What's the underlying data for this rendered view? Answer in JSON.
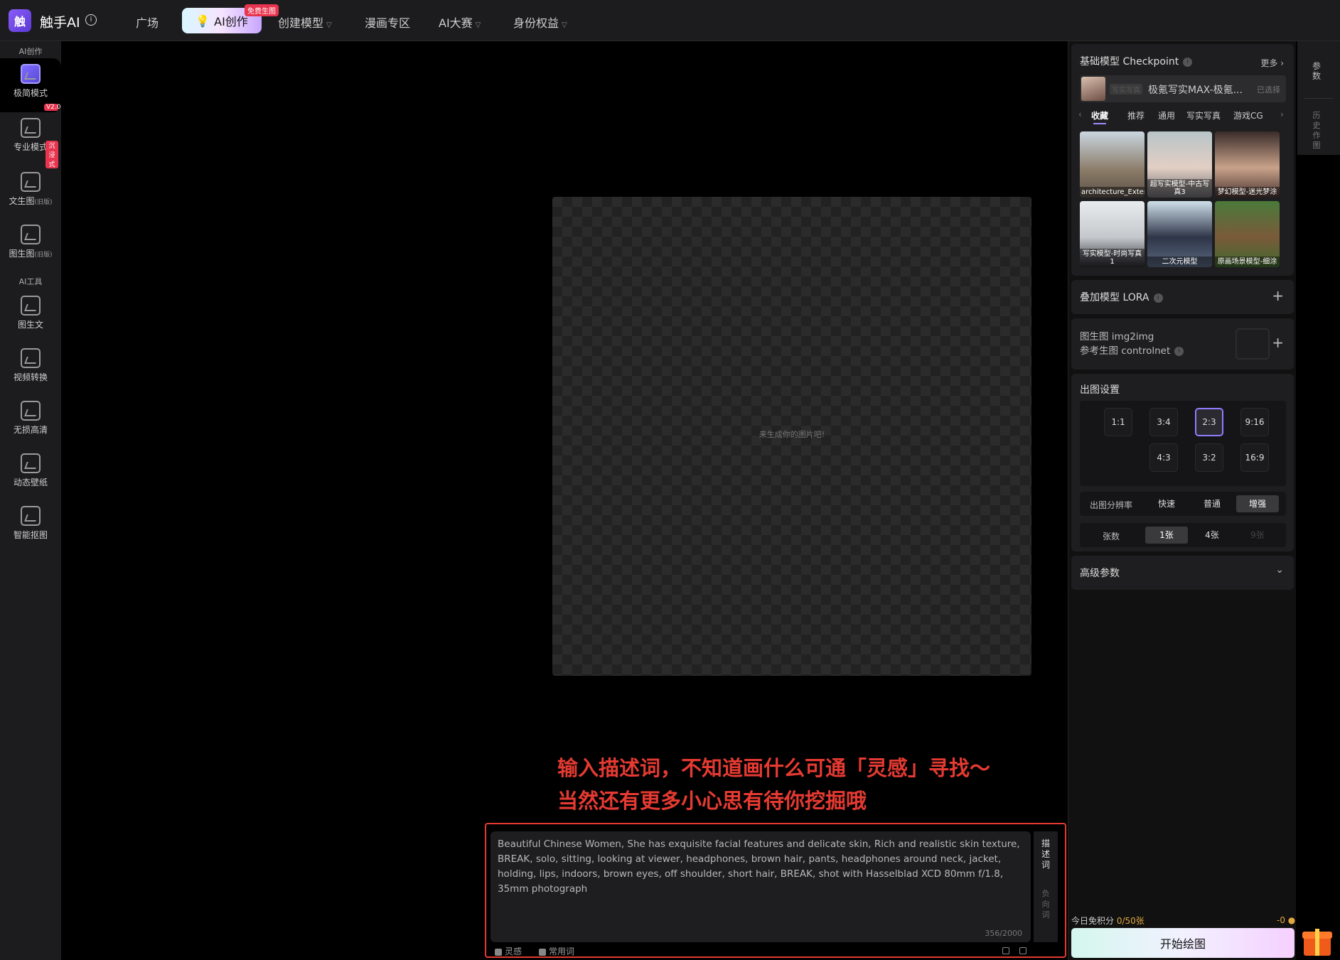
{
  "brand": {
    "name": "触手AI",
    "logo_char": "触"
  },
  "nav": {
    "items": [
      {
        "label": "广场"
      },
      {
        "label": "AI创作",
        "badge": "免费生图"
      },
      {
        "label": "创建模型"
      },
      {
        "label": "漫画专区"
      },
      {
        "label": "AI大赛"
      },
      {
        "label": "身份权益"
      }
    ]
  },
  "sidebar": {
    "section1": "AI创作",
    "section2": "AI工具",
    "items": [
      {
        "label": "极简模式",
        "badge": "V2.0"
      },
      {
        "label": "专业模式",
        "badge": "沉浸式"
      },
      {
        "label": "文生图",
        "sub": "(旧版)"
      },
      {
        "label": "图生图",
        "sub": "(旧版)"
      },
      {
        "label": "图生文"
      },
      {
        "label": "视频转换"
      },
      {
        "label": "无损高清"
      },
      {
        "label": "动态壁纸"
      },
      {
        "label": "智能抠图"
      }
    ]
  },
  "canvas": {
    "hint": "来生成你的图片吧!"
  },
  "annotation": {
    "line1": "输入描述词，不知道画什么可通「灵感」寻找～",
    "line2": "当然还有更多小心思有待你挖掘哦"
  },
  "prompt": {
    "text": "Beautiful Chinese Women,  She has exquisite facial features and delicate skin,  Rich and realistic skin texture,  BREAK,  solo,  sitting,  looking at viewer,  headphones,  brown hair,  pants,  headphones around neck,  jacket,  holding,  lips,  indoors,  brown eyes,  off shoulder,  short hair,  BREAK,  shot with Hasselblad XCD 80mm f/1.8,  35mm photograph",
    "count": "356/2000",
    "tab_positive": "描述词",
    "tab_negative": "负向词",
    "inspiration": "灵感",
    "common_words": "常用词"
  },
  "panel": {
    "checkpoint_title": "基础模型 Checkpoint",
    "more": "更多",
    "selected_tag": "写实写真",
    "selected_model": "极氪写实MAX-极氪...",
    "selected_state": "已选择",
    "tabs": [
      "收藏",
      "推荐",
      "通用",
      "写实写真",
      "游戏CG"
    ],
    "models": [
      {
        "name": "architecture_Exterior"
      },
      {
        "name": "超写实模型-中古写真3"
      },
      {
        "name": "梦幻模型-迷光梦涂"
      },
      {
        "name": "写实模型-时尚写真1"
      },
      {
        "name": "二次元模型"
      },
      {
        "name": "原画场景模型-细涂"
      }
    ],
    "lora_title": "叠加模型 LORA",
    "img2img_title": "图生图 img2img",
    "controlnet_title": "参考生图 controlnet",
    "output_title": "出图设置",
    "ratios": [
      "1:1",
      "3:4",
      "2:3",
      "9:16",
      "4:3",
      "3:2",
      "16:9"
    ],
    "selected_ratio": "2:3",
    "resolution_label": "出图分辨率",
    "resolution_opts": [
      "快速",
      "普通",
      "增强"
    ],
    "selected_resolution": "增强",
    "count_label": "张数",
    "count_opts": [
      "1张",
      "4张",
      "9张"
    ],
    "selected_count": "1张",
    "advanced_title": "高级参数"
  },
  "footer": {
    "credit_label": "今日免积分",
    "credit_value": "0/50张",
    "credit_cost": "-0",
    "start_button": "开始绘图"
  },
  "side_tabs": {
    "params": "参数",
    "history": "历史作图"
  },
  "colors": {
    "accent": "#8f7dff",
    "annotation": "#e53a32",
    "badge": "#e8344e"
  }
}
